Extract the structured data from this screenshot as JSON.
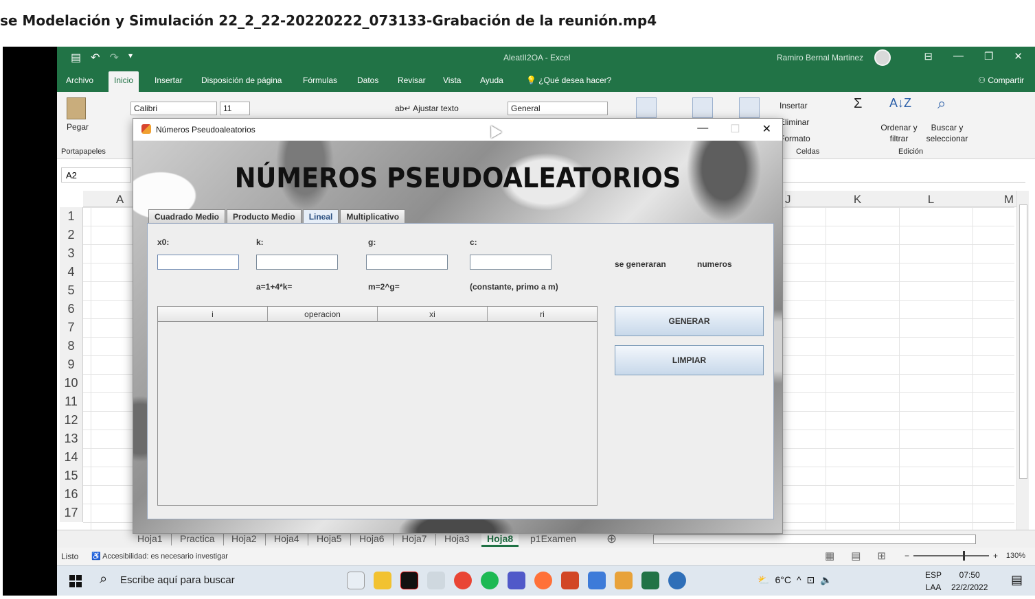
{
  "video_title": "se Modelación y Simulación 22_2_22-20220222_073133-Grabación de la reunión.mp4",
  "excel": {
    "doc_title": "AleatII2OA  -  Excel",
    "user_name": "Ramiro Bernal Martinez",
    "tabs": [
      "Archivo",
      "Inicio",
      "Insertar",
      "Disposición de página",
      "Fórmulas",
      "Datos",
      "Revisar",
      "Vista",
      "Ayuda"
    ],
    "active_tab": "Inicio",
    "tell_me": "¿Qué desea hacer?",
    "share": "Compartir",
    "ribbon": {
      "paste": "Pegar",
      "clipboard_group": "Portapapeles",
      "font_name": "Calibri",
      "font_size": "11",
      "wrap_text": "Ajustar texto",
      "number_format": "General",
      "insert": "Insertar",
      "delete": "Eliminar",
      "format": "Formato",
      "cells_group": "Celdas",
      "sort_filter": "Ordenar y filtrar",
      "find_select": "Buscar y seleccionar",
      "editing_group": "Edición"
    },
    "name_box": "A2",
    "columns": [
      "A",
      "J",
      "K",
      "L",
      "M"
    ],
    "rows": [
      "1",
      "2",
      "3",
      "4",
      "5",
      "6",
      "7",
      "8",
      "9",
      "10",
      "11",
      "12",
      "13",
      "14",
      "15",
      "16",
      "17"
    ],
    "sheets": [
      "Hoja1",
      "Practica",
      "Hoja2",
      "Hoja4",
      "Hoja5",
      "Hoja6",
      "Hoja7",
      "Hoja3",
      "Hoja8",
      "p1Examen"
    ],
    "active_sheet": "Hoja8",
    "status_ready": "Listo",
    "accessibility": "Accesibilidad: es necesario investigar",
    "zoom": "130%"
  },
  "dialog": {
    "title": "Números Pseudoaleatorios",
    "banner": "NÚMEROS PSEUDOALEATORIOS",
    "tabs": [
      "Cuadrado Medio",
      "Producto Medio",
      "Lineal",
      "Multiplicativo"
    ],
    "active_tab": "Lineal",
    "labels": {
      "x0": "x0:",
      "k": "k:",
      "g": "g:",
      "c": "c:",
      "a_formula": "a=1+4*k=",
      "m_formula": "m=2^g=",
      "c_note": "(constante, primo a m)",
      "se_generaran": "se generaran",
      "numeros": "numeros"
    },
    "inputs": {
      "x0": "",
      "k": "",
      "g": "",
      "c": ""
    },
    "table_headers": [
      "i",
      "operacion",
      "xi",
      "ri"
    ],
    "buttons": {
      "generate": "GENERAR",
      "clear": "LIMPIAR"
    }
  },
  "taskbar": {
    "search_placeholder": "Escribe aquí para buscar",
    "weather": "6°C",
    "lang": "ESP",
    "lang_sub": "LAA",
    "time": "07:50",
    "date": "22/2/2022"
  },
  "colors": {
    "excel_green": "#217346",
    "swing_button": "#c7d8ea"
  }
}
